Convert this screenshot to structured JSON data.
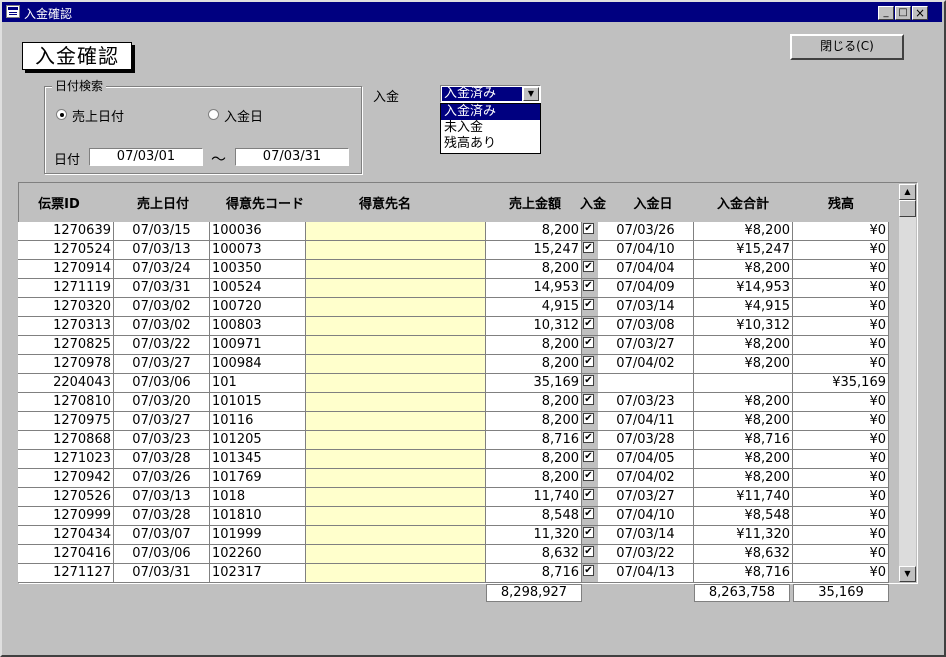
{
  "window": {
    "title": "入金確認",
    "minimize": "_",
    "maximize": "□",
    "close": "×"
  },
  "form": {
    "heading": "入金確認",
    "close_button": "閉じる(C)"
  },
  "search": {
    "group_label": "日付検索",
    "radio_sales_date": "売上日付",
    "radio_payment_date": "入金日",
    "date_label": "日付",
    "date_from": "07/03/01",
    "separator": "～",
    "date_to": "07/03/31"
  },
  "payment_filter": {
    "label": "入金",
    "selected": "入金済み",
    "arrow": "▼",
    "options": [
      "入金済み",
      "未入金",
      "残高あり"
    ]
  },
  "table": {
    "headers": [
      "伝票ID",
      "売上日付",
      "得意先コード",
      "得意先名",
      "売上金額",
      "入金",
      "入金日",
      "入金合計",
      "残高"
    ],
    "rows": [
      [
        "1270639",
        "07/03/15",
        "100036",
        "",
        "8,200",
        "✔",
        "07/03/26",
        "¥8,200",
        "¥0"
      ],
      [
        "1270524",
        "07/03/13",
        "100073",
        "",
        "15,247",
        "✔",
        "07/04/10",
        "¥15,247",
        "¥0"
      ],
      [
        "1270914",
        "07/03/24",
        "100350",
        "",
        "8,200",
        "✔",
        "07/04/04",
        "¥8,200",
        "¥0"
      ],
      [
        "1271119",
        "07/03/31",
        "100524",
        "",
        "14,953",
        "✔",
        "07/04/09",
        "¥14,953",
        "¥0"
      ],
      [
        "1270320",
        "07/03/02",
        "100720",
        "",
        "4,915",
        "✔",
        "07/03/14",
        "¥4,915",
        "¥0"
      ],
      [
        "1270313",
        "07/03/02",
        "100803",
        "",
        "10,312",
        "✔",
        "07/03/08",
        "¥10,312",
        "¥0"
      ],
      [
        "1270825",
        "07/03/22",
        "100971",
        "",
        "8,200",
        "✔",
        "07/03/27",
        "¥8,200",
        "¥0"
      ],
      [
        "1270978",
        "07/03/27",
        "100984",
        "",
        "8,200",
        "✔",
        "07/04/02",
        "¥8,200",
        "¥0"
      ],
      [
        "2204043",
        "07/03/06",
        "101",
        "",
        "35,169",
        "✔",
        "",
        "",
        "¥35,169"
      ],
      [
        "1270810",
        "07/03/20",
        "101015",
        "",
        "8,200",
        "✔",
        "07/03/23",
        "¥8,200",
        "¥0"
      ],
      [
        "1270975",
        "07/03/27",
        "10116",
        "",
        "8,200",
        "✔",
        "07/04/11",
        "¥8,200",
        "¥0"
      ],
      [
        "1270868",
        "07/03/23",
        "101205",
        "",
        "8,716",
        "✔",
        "07/03/28",
        "¥8,716",
        "¥0"
      ],
      [
        "1271023",
        "07/03/28",
        "101345",
        "",
        "8,200",
        "✔",
        "07/04/05",
        "¥8,200",
        "¥0"
      ],
      [
        "1270942",
        "07/03/26",
        "101769",
        "",
        "8,200",
        "✔",
        "07/04/02",
        "¥8,200",
        "¥0"
      ],
      [
        "1270526",
        "07/03/13",
        "1018",
        "",
        "11,740",
        "✔",
        "07/03/27",
        "¥11,740",
        "¥0"
      ],
      [
        "1270999",
        "07/03/28",
        "101810",
        "",
        "8,548",
        "✔",
        "07/04/10",
        "¥8,548",
        "¥0"
      ],
      [
        "1270434",
        "07/03/07",
        "101999",
        "",
        "11,320",
        "✔",
        "07/03/14",
        "¥11,320",
        "¥0"
      ],
      [
        "1270416",
        "07/03/06",
        "102260",
        "",
        "8,632",
        "✔",
        "07/03/22",
        "¥8,632",
        "¥0"
      ],
      [
        "1271127",
        "07/03/31",
        "102317",
        "",
        "8,716",
        "✔",
        "07/04/13",
        "¥8,716",
        "¥0"
      ]
    ],
    "totals": {
      "sales": "8,298,927",
      "payment": "8,263,758",
      "balance": "35,169"
    },
    "scroll_up": "▲",
    "scroll_down": "▼"
  }
}
